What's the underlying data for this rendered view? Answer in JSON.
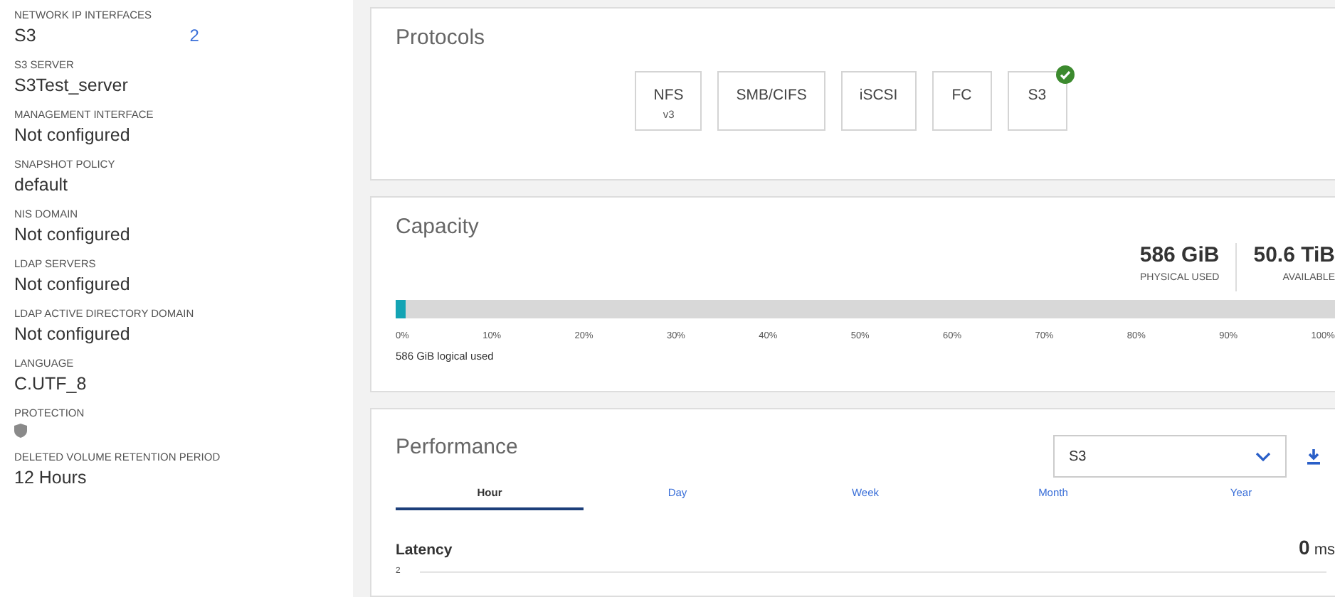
{
  "details": [
    {
      "kind": "text",
      "label": "NETWORK IP INTERFACES",
      "value": "S3",
      "count": "2"
    },
    {
      "kind": "text",
      "label": "S3 SERVER",
      "value": "S3Test_server"
    },
    {
      "kind": "text",
      "label": "MANAGEMENT INTERFACE",
      "value": "Not configured"
    },
    {
      "kind": "text",
      "label": "SNAPSHOT POLICY",
      "value": "default"
    },
    {
      "kind": "text",
      "label": "NIS DOMAIN",
      "value": "Not configured"
    },
    {
      "kind": "text",
      "label": "LDAP SERVERS",
      "value": "Not configured"
    },
    {
      "kind": "text",
      "label": "LDAP ACTIVE DIRECTORY DOMAIN",
      "value": "Not configured"
    },
    {
      "kind": "text",
      "label": "LANGUAGE",
      "value": "C.UTF_8"
    },
    {
      "kind": "shield",
      "label": "PROTECTION"
    },
    {
      "kind": "text",
      "label": "DELETED VOLUME RETENTION PERIOD",
      "value": "12 Hours"
    }
  ],
  "protocols": {
    "title": "Protocols",
    "items": [
      {
        "name": "NFS",
        "version": "v3",
        "enabled": false
      },
      {
        "name": "SMB/CIFS",
        "enabled": false
      },
      {
        "name": "iSCSI",
        "enabled": false
      },
      {
        "name": "FC",
        "enabled": false
      },
      {
        "name": "S3",
        "enabled": true
      }
    ]
  },
  "capacity": {
    "title": "Capacity",
    "stats": [
      {
        "value": "586 GiB",
        "label": "PHYSICAL USED"
      },
      {
        "value": "50.6 TiB",
        "label": "AVAILABLE"
      }
    ],
    "level": 0.01,
    "ticks": [
      "0%",
      "10%",
      "20%",
      "30%",
      "40%",
      "50%",
      "60%",
      "70%",
      "80%",
      "90%",
      "100%"
    ],
    "note": "586 GiB logical used"
  },
  "performance": {
    "title": "Performance",
    "select": "S3",
    "tabs": [
      {
        "label": "Hour",
        "selected": true
      },
      {
        "label": "Day",
        "selected": false
      },
      {
        "label": "Week",
        "selected": false
      },
      {
        "label": "Month",
        "selected": false
      },
      {
        "label": "Year",
        "selected": false
      }
    ],
    "latency": {
      "title": "Latency",
      "value": "0",
      "unit": "ms",
      "axis_label": "2"
    }
  }
}
